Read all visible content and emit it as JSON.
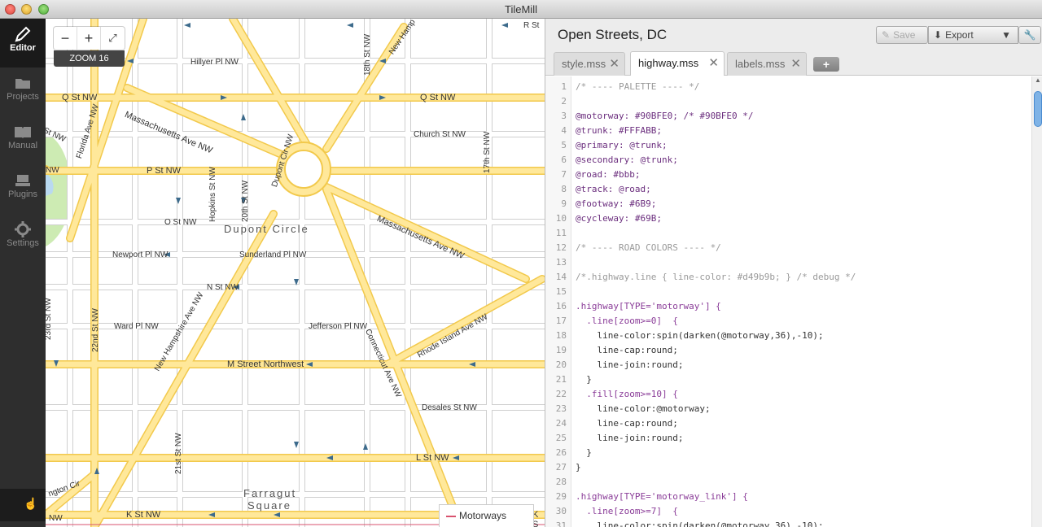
{
  "window": {
    "title": "TileMill"
  },
  "sidebar": {
    "items": [
      {
        "label": "Editor",
        "icon": "pencil-icon"
      },
      {
        "label": "Projects",
        "icon": "folder-icon"
      },
      {
        "label": "Manual",
        "icon": "book-icon"
      },
      {
        "label": "Plugins",
        "icon": "plugin-icon"
      },
      {
        "label": "Settings",
        "icon": "gear-icon"
      }
    ]
  },
  "map": {
    "zoom_out": "−",
    "zoom_in": "+",
    "fullscreen": "⤢",
    "zoom_label": "ZOOM 16",
    "legend": "Motorways",
    "labels": {
      "q_st_left": "Q St NW",
      "q_st_right": "Q St NW",
      "r_st": "R St",
      "hillyer": "Hillyer Pl NW",
      "massachusetts_nw": "Massachusetts Ave NW",
      "massachusetts_se": "Massachusetts Ave NW",
      "florida": "Florida Ave NW",
      "new_hampshire_top": "New Hamp",
      "church": "Church St NW",
      "p_st": "P St NW",
      "dupont_cir": "Dupont Cir NW",
      "hopkins": "Hopkins St NW",
      "twentieth": "20th St NW",
      "eighteenth": "18th St NW",
      "seventeenth": "17th St NW",
      "o_st": "O St NW",
      "dupont_circle": "Dupont Circle",
      "newport": "Newport Pl NW",
      "sunderland": "Sunderland Pl NW",
      "n_st": "N St NW",
      "new_hampshire": "New Hampshire Ave NW",
      "twentythird": "23rd St NW",
      "twentysecond": "22nd St NW",
      "ward": "Ward Pl NW",
      "jefferson": "Jefferson Pl NW",
      "connecticut": "Connecticut Ave NW",
      "rhode_island": "Rhode Island Ave NW",
      "m_street": "M Street Northwest",
      "desales": "Desales St NW",
      "twentyfirst": "21st St NW",
      "l_st": "L St NW",
      "farragut": "Farragut",
      "square": "Square",
      "k_st": "K St NW",
      "k_s": "K S",
      "ngton_cir": "ngton Cir",
      "nw_bottom": "NW",
      "sw_left": "St NW",
      "nw_left": "NW"
    }
  },
  "editor": {
    "project_title": "Open Streets, DC",
    "save_label": "Save",
    "export_label": "Export",
    "tabs": [
      {
        "label": "style.mss"
      },
      {
        "label": "highway.mss"
      },
      {
        "label": "labels.mss"
      }
    ],
    "add_tab": "+",
    "code_lines": [
      "/* ---- PALETTE ---- */",
      "",
      "@motorway: #90BFE0; /* #90BFE0 */",
      "@trunk: #FFFABB;",
      "@primary: @trunk;",
      "@secondary: @trunk;",
      "@road: #bbb;",
      "@track: @road;",
      "@footway: #6B9;",
      "@cycleway: #69B;",
      "",
      "/* ---- ROAD COLORS ---- */",
      "",
      "/*.highway.line { line-color: #d49b9b; } /* debug */",
      "",
      ".highway[TYPE='motorway'] {",
      "  .line[zoom>=0]  {",
      "    line-color:spin(darken(@motorway,36),-10);",
      "    line-cap:round;",
      "    line-join:round;",
      "  }",
      "  .fill[zoom>=10] {",
      "    line-color:@motorway;",
      "    line-cap:round;",
      "    line-join:round;",
      "  }",
      "}",
      "",
      ".highway[TYPE='motorway_link'] {",
      "  .line[zoom>=7]  {",
      "    line-color:spin(darken(@motorway,36),-10);"
    ]
  },
  "colors": {
    "sidebar_bg": "#2e2e2e",
    "major_road": "#ffe89a",
    "road_casing": "#f2c94c",
    "minor_road": "#cfcfcf",
    "park": "#cdebb3",
    "water": "#b9d9f0",
    "oneway_arrow": "#3d6b8c"
  }
}
